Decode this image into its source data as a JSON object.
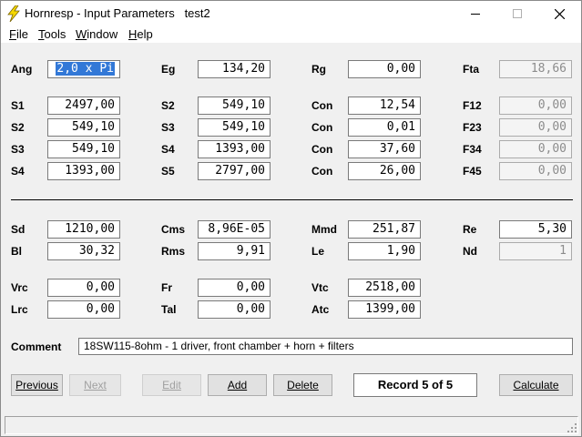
{
  "window": {
    "title": "Hornresp - Input Parameters   test2",
    "minimize_label": "",
    "maximize_label": "",
    "close_label": ""
  },
  "menu": [
    {
      "prefix": "",
      "accel": "F",
      "rest": "ile"
    },
    {
      "prefix": "",
      "accel": "T",
      "rest": "ools"
    },
    {
      "prefix": "",
      "accel": "W",
      "rest": "indow"
    },
    {
      "prefix": "",
      "accel": "H",
      "rest": "elp"
    }
  ],
  "params": {
    "ang": {
      "label": "Ang",
      "value": "2,0 x Pi"
    },
    "eg": {
      "label": "Eg",
      "value": "134,20"
    },
    "rg": {
      "label": "Rg",
      "value": "0,00"
    },
    "fta": {
      "label": "Fta",
      "value": "18,66"
    },
    "s1_left": {
      "label": "S1",
      "value": "2497,00"
    },
    "s2_left": {
      "label": "S2",
      "value": "549,10"
    },
    "s3_left": {
      "label": "S3",
      "value": "549,10"
    },
    "s4_left": {
      "label": "S4",
      "value": "1393,00"
    },
    "s2_mid": {
      "label": "S2",
      "value": "549,10"
    },
    "s3_mid": {
      "label": "S3",
      "value": "549,10"
    },
    "s4_mid": {
      "label": "S4",
      "value": "1393,00"
    },
    "s5_mid": {
      "label": "S5",
      "value": "2797,00"
    },
    "con1": {
      "label": "Con",
      "value": "12,54"
    },
    "con2": {
      "label": "Con",
      "value": "0,01"
    },
    "con3": {
      "label": "Con",
      "value": "37,60"
    },
    "con4": {
      "label": "Con",
      "value": "26,00"
    },
    "f12": {
      "label": "F12",
      "value": "0,00"
    },
    "f23": {
      "label": "F23",
      "value": "0,00"
    },
    "f34": {
      "label": "F34",
      "value": "0,00"
    },
    "f45": {
      "label": "F45",
      "value": "0,00"
    },
    "sd": {
      "label": "Sd",
      "value": "1210,00"
    },
    "bl": {
      "label": "Bl",
      "value": "30,32"
    },
    "cms": {
      "label": "Cms",
      "value": "8,96E-05"
    },
    "rms": {
      "label": "Rms",
      "value": "9,91"
    },
    "mmd": {
      "label": "Mmd",
      "value": "251,87"
    },
    "le": {
      "label": "Le",
      "value": "1,90"
    },
    "re": {
      "label": "Re",
      "value": "5,30"
    },
    "nd": {
      "label": "Nd",
      "value": "1"
    },
    "vrc": {
      "label": "Vrc",
      "value": "0,00"
    },
    "lrc": {
      "label": "Lrc",
      "value": "0,00"
    },
    "fr": {
      "label": "Fr",
      "value": "0,00"
    },
    "tal": {
      "label": "Tal",
      "value": "0,00"
    },
    "vtc": {
      "label": "Vtc",
      "value": "2518,00"
    },
    "atc": {
      "label": "Atc",
      "value": "1399,00"
    }
  },
  "comment": {
    "label": "Comment",
    "value": "18SW115-8ohm - 1 driver, front chamber + horn + filters"
  },
  "buttons": {
    "previous": "Previous",
    "next": "Next",
    "edit": "Edit",
    "add": "Add",
    "delete": "Delete",
    "calculate": "Calculate"
  },
  "record": "Record 5 of 5",
  "colors": {
    "window_bg": "#f0f0f0",
    "selection": "#3278d7",
    "readonly_text": "#8c8c8c",
    "disabled_text": "#a0a0a0",
    "icon_yellow": "#f5d800"
  }
}
